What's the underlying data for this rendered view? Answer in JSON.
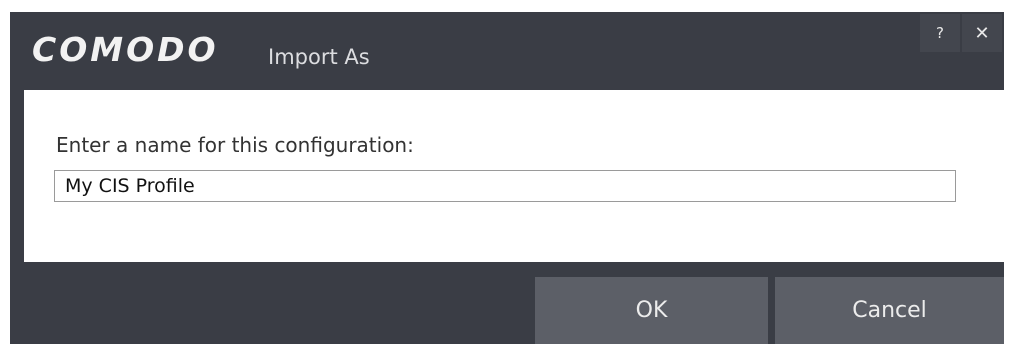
{
  "titlebar": {
    "brand": "COMODO",
    "title": "Import As",
    "help_label": "?",
    "close_label": "✕"
  },
  "form": {
    "prompt": "Enter a name for this configuration:",
    "config_name_value": "My CIS Profile"
  },
  "buttons": {
    "ok_label": "OK",
    "cancel_label": "Cancel"
  },
  "colors": {
    "dialog_bg": "#3a3d45",
    "content_bg": "#ffffff",
    "button_bg": "#5c5f67"
  }
}
